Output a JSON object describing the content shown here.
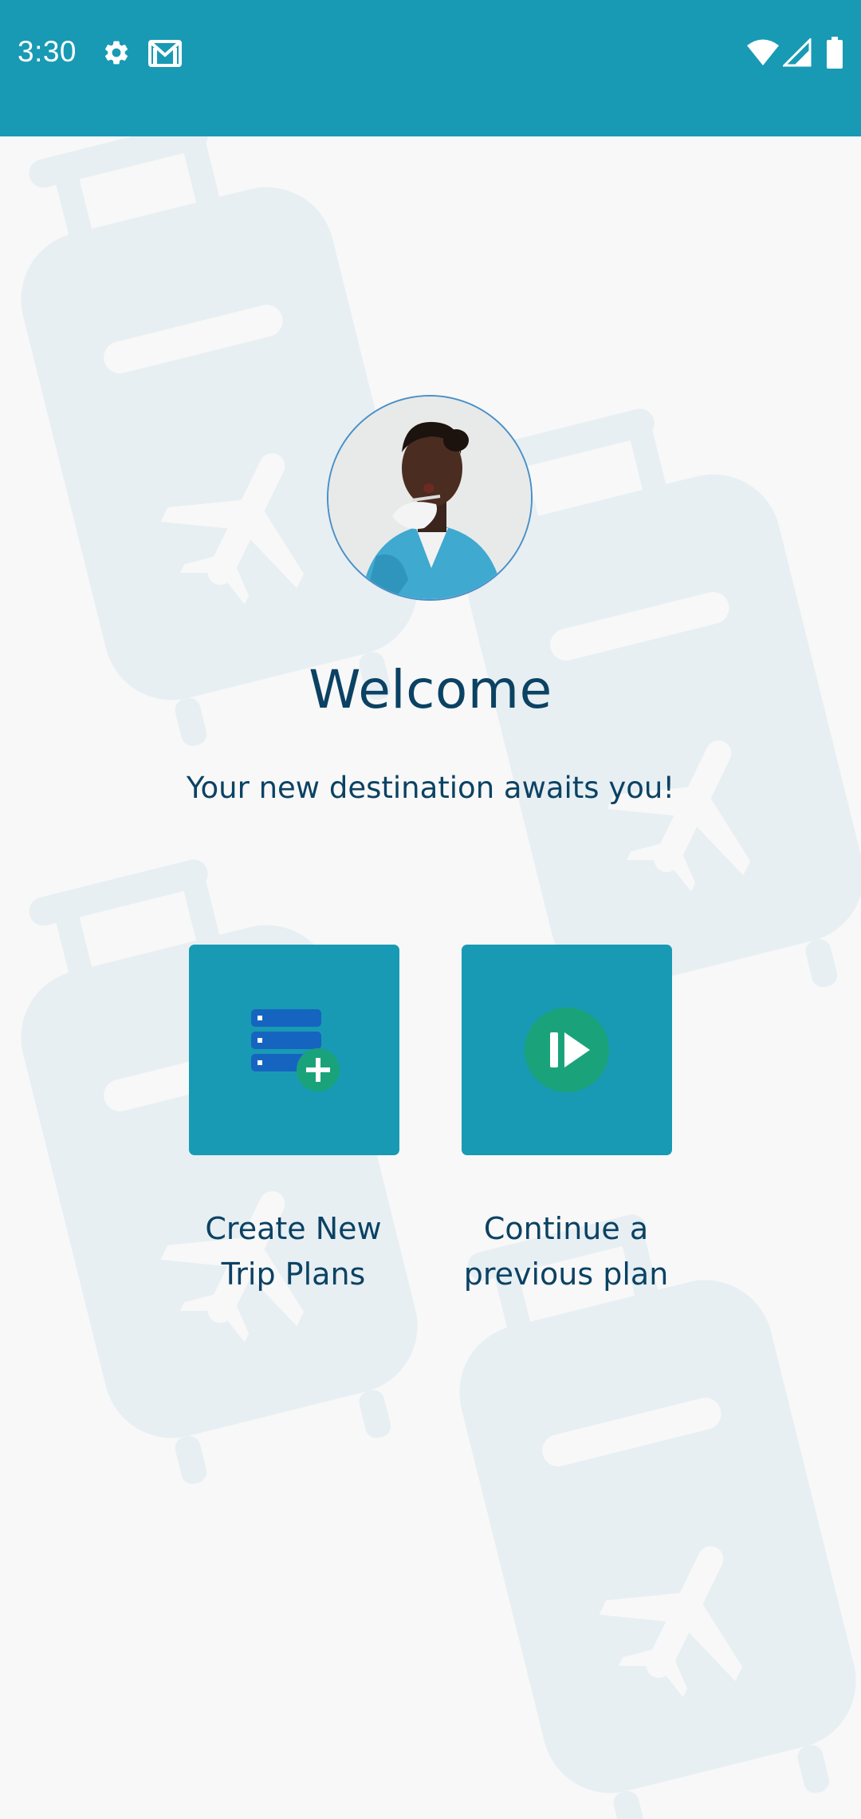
{
  "status_bar": {
    "time": "3:30",
    "icons": [
      "settings-icon",
      "gmail-icon",
      "wifi-icon",
      "signal-icon",
      "battery-icon"
    ]
  },
  "background": {
    "decoration": "luggage-with-airplane-pattern"
  },
  "welcome": {
    "title": "Welcome",
    "subtitle": "Your new destination awaits you!"
  },
  "actions": [
    {
      "label_line1": "Create New",
      "label_line2": "Trip Plans",
      "icon": "add-list-icon"
    },
    {
      "label_line1": "Continue a",
      "label_line2": "previous plan",
      "icon": "play-circle-icon"
    }
  ],
  "colors": {
    "primary": "#189ab4",
    "text": "#0b4263",
    "accent_green": "#1aa37a",
    "icon_blue": "#1565c0",
    "background": "#f8f8f8",
    "pattern": "#e7eff3"
  }
}
